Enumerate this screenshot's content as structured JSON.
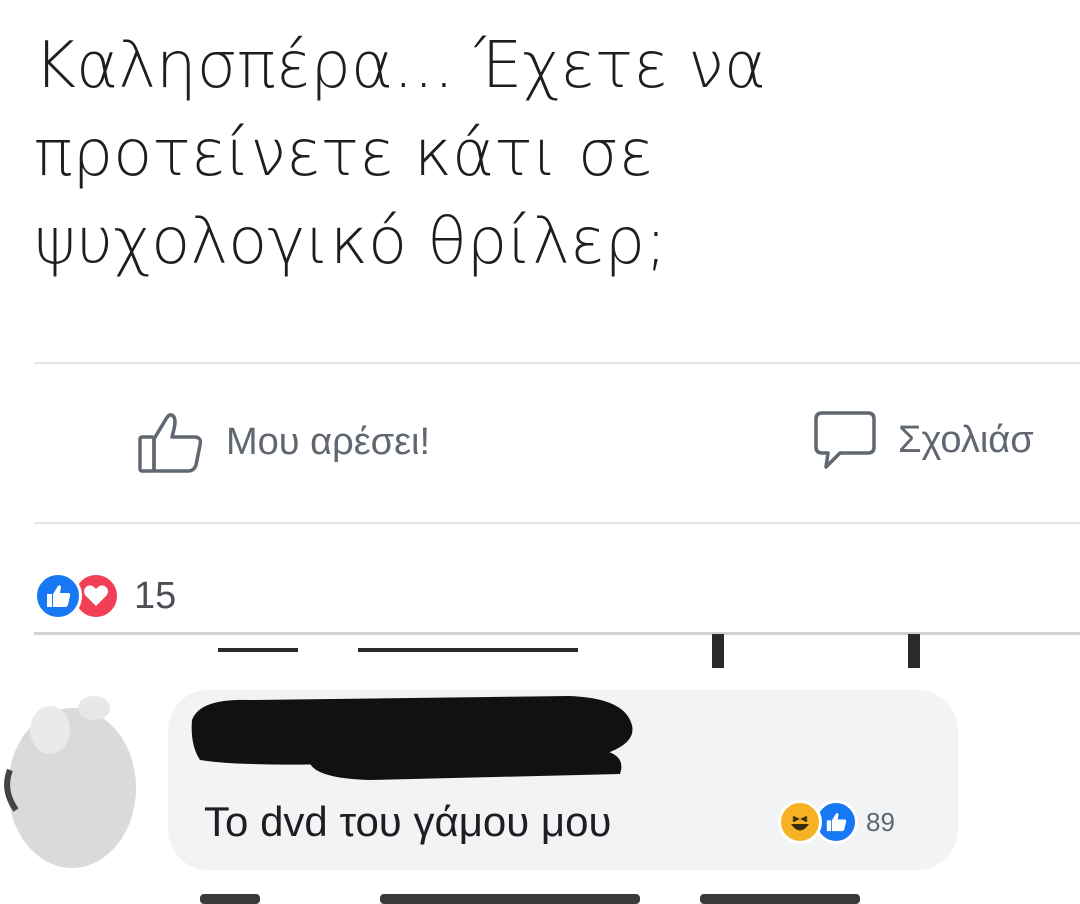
{
  "post": {
    "lines": [
      "Καλησπέρα... Έχετε να",
      "προτείνετε κάτι σε",
      "ψυχολογικό θρίλερ;"
    ]
  },
  "actions": {
    "like_label": "Μου αρέσει!",
    "comment_label": "Σχολιάσ"
  },
  "reactions": {
    "icons": [
      "like-icon",
      "love-icon"
    ],
    "count": "15",
    "like_color": "#1877f2",
    "love_color": "#f33e58"
  },
  "comment": {
    "author": "[redacted]",
    "text": "Το dvd του γάμου μου",
    "reaction_icons": [
      "haha-icon",
      "like-icon"
    ],
    "reaction_count": "89"
  }
}
